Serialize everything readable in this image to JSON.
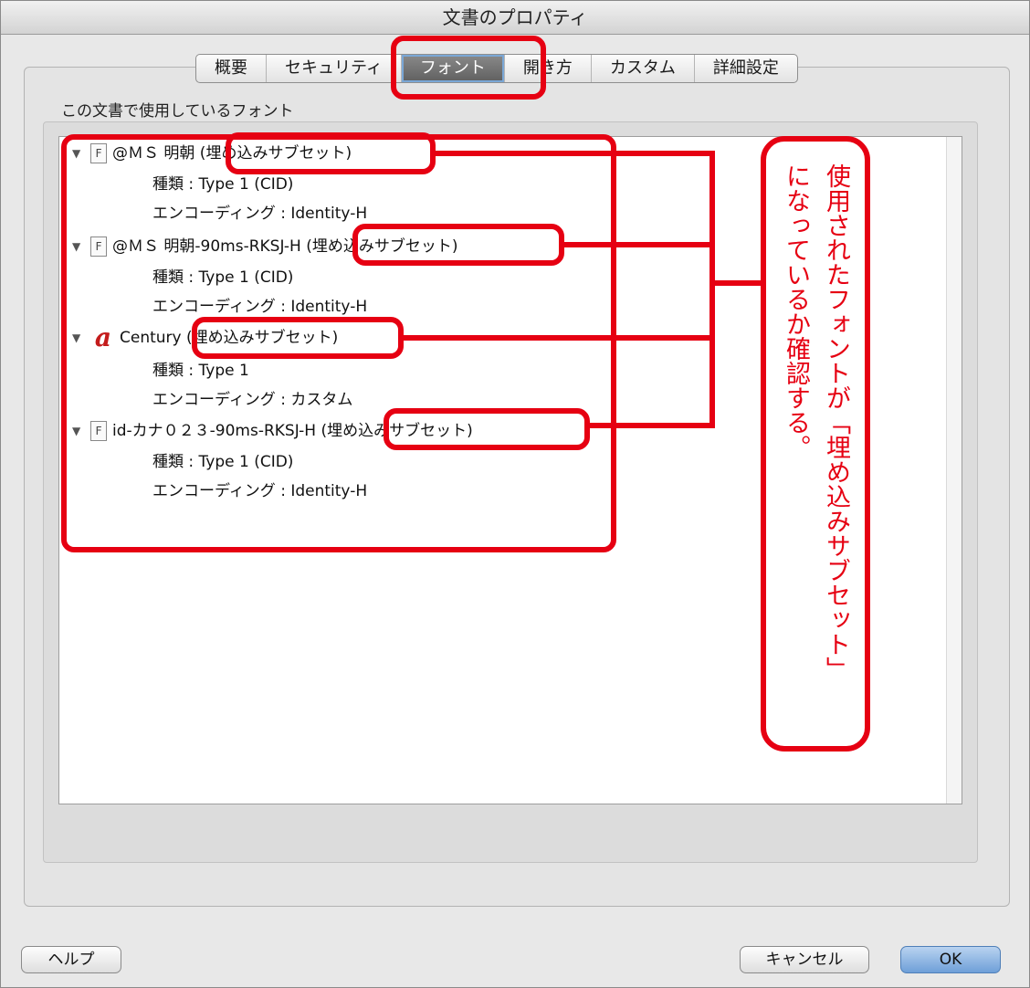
{
  "window": {
    "title": "文書のプロパティ"
  },
  "tabs": [
    {
      "label": "概要"
    },
    {
      "label": "セキュリティ"
    },
    {
      "label": "フォント"
    },
    {
      "label": "開き方"
    },
    {
      "label": "カスタム"
    },
    {
      "label": "詳細設定"
    }
  ],
  "selected_tab": "フォント",
  "fonts_section": {
    "label": "この文書で使用しているフォント",
    "fonts": [
      {
        "name": "@ＭＳ 明朝 (埋め込みサブセット)",
        "icon": "font-file-icon",
        "type": "種類 : Type 1 (CID)",
        "encoding": "エンコーディング : Identity-H"
      },
      {
        "name": "@ＭＳ 明朝-90ms-RKSJ-H (埋め込みサブセット)",
        "icon": "font-file-icon",
        "type": "種類 : Type 1 (CID)",
        "encoding": "エンコーディング : Identity-H"
      },
      {
        "name": "Century (埋め込みサブセット)",
        "icon": "type1-font-icon",
        "type": "種類 : Type 1",
        "encoding": "エンコーディング : カスタム"
      },
      {
        "name": "id-カナ０２３-90ms-RKSJ-H (埋め込みサブセット)",
        "icon": "font-file-icon",
        "type": "種類 : Type 1 (CID)",
        "encoding": "エンコーディング : Identity-H"
      }
    ]
  },
  "annotation": {
    "column1": "使用されたフォントが「埋め込みサブセット」",
    "column2": "になっているか確認する。",
    "color": "#e60012"
  },
  "buttons": {
    "help": "ヘルプ",
    "cancel": "キャンセル",
    "ok": "OK"
  }
}
